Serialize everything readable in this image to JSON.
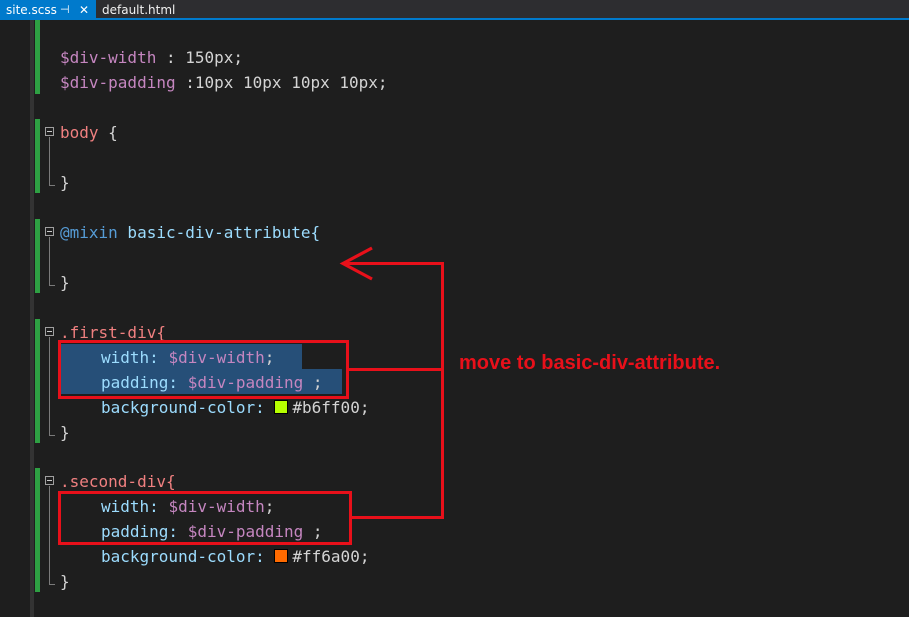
{
  "tabs": [
    {
      "label": "site.scss",
      "active": true,
      "pin": "⊣",
      "close": "✕"
    },
    {
      "label": "default.html",
      "active": false
    }
  ],
  "code": {
    "l1_var": "$div-width",
    "l1_rest": " : 150px;",
    "l2_var": "$div-padding",
    "l2_rest": " :10px 10px 10px 10px;",
    "body_sel": "body",
    "body_open": " {",
    "close_brace": "}",
    "mixin_kw": "@mixin",
    "mixin_name": " basic-div-attribute{",
    "first_sel": ".first-div{",
    "width_prop": "width: ",
    "width_var": "$div-width",
    "semicolon": ";",
    "padding_prop": "padding: ",
    "padding_var": "$div-padding",
    "padding_end": " ;",
    "bg_prop": "background-color: ",
    "first_color_text": "#b6ff00;",
    "second_sel": ".second-div{",
    "second_color_text": "#ff6a00;"
  },
  "colors": {
    "first_swatch": "#b6ff00",
    "second_swatch": "#ff6a00",
    "annotation": "#e8101a"
  },
  "annotation": {
    "text": "move to basic-div-attribute."
  }
}
